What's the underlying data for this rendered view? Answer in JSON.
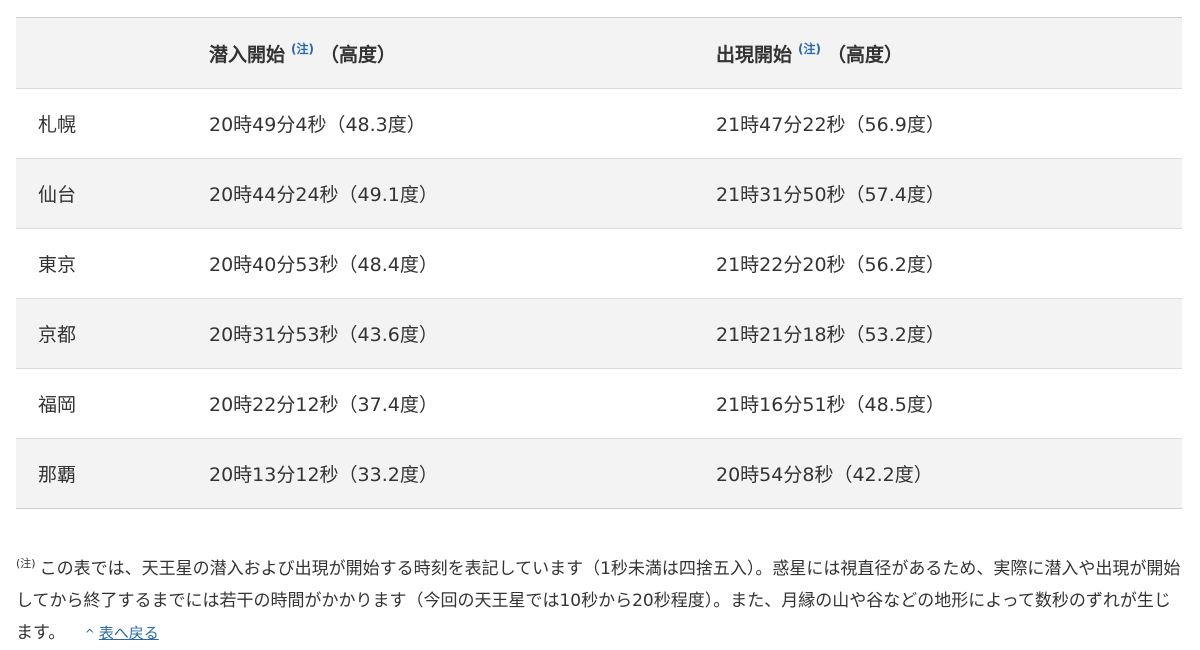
{
  "table": {
    "headers": {
      "city": "",
      "immersion": "潜入開始",
      "immersion_note": "(注)",
      "immersion_unit": "（高度）",
      "emersion": "出現開始",
      "emersion_note": "(注)",
      "emersion_unit": "（高度）"
    },
    "rows": [
      {
        "city": "札幌",
        "immersion": "20時49分4秒（48.3度）",
        "emersion": "21時47分22秒（56.9度）"
      },
      {
        "city": "仙台",
        "immersion": "20時44分24秒（49.1度）",
        "emersion": "21時31分50秒（57.4度）"
      },
      {
        "city": "東京",
        "immersion": "20時40分53秒（48.4度）",
        "emersion": "21時22分20秒（56.2度）"
      },
      {
        "city": "京都",
        "immersion": "20時31分53秒（43.6度）",
        "emersion": "21時21分18秒（53.2度）"
      },
      {
        "city": "福岡",
        "immersion": "20時22分12秒（37.4度）",
        "emersion": "21時16分51秒（48.5度）"
      },
      {
        "city": "那覇",
        "immersion": "20時13分12秒（33.2度）",
        "emersion": "20時54分8秒（42.2度）"
      }
    ]
  },
  "footnote": {
    "mark": "(注)",
    "text": "この表では、天王星の潜入および出現が開始する時刻を表記しています（1秒未満は四捨五入）。惑星には視直径があるため、実際に潜入や出現が開始してから終了するまでには若干の時間がかかります（今回の天王星では10秒から20秒程度）。また、月縁の山や谷などの地形によって数秒のずれが生じます。",
    "back_link_icon": "^",
    "back_link_label": "表へ戻る"
  },
  "colors": {
    "link": "#2a6aa8",
    "header_bg": "#f3f3f3",
    "stripe_bg": "#f3f3f3",
    "border": "#dcdcdc"
  }
}
